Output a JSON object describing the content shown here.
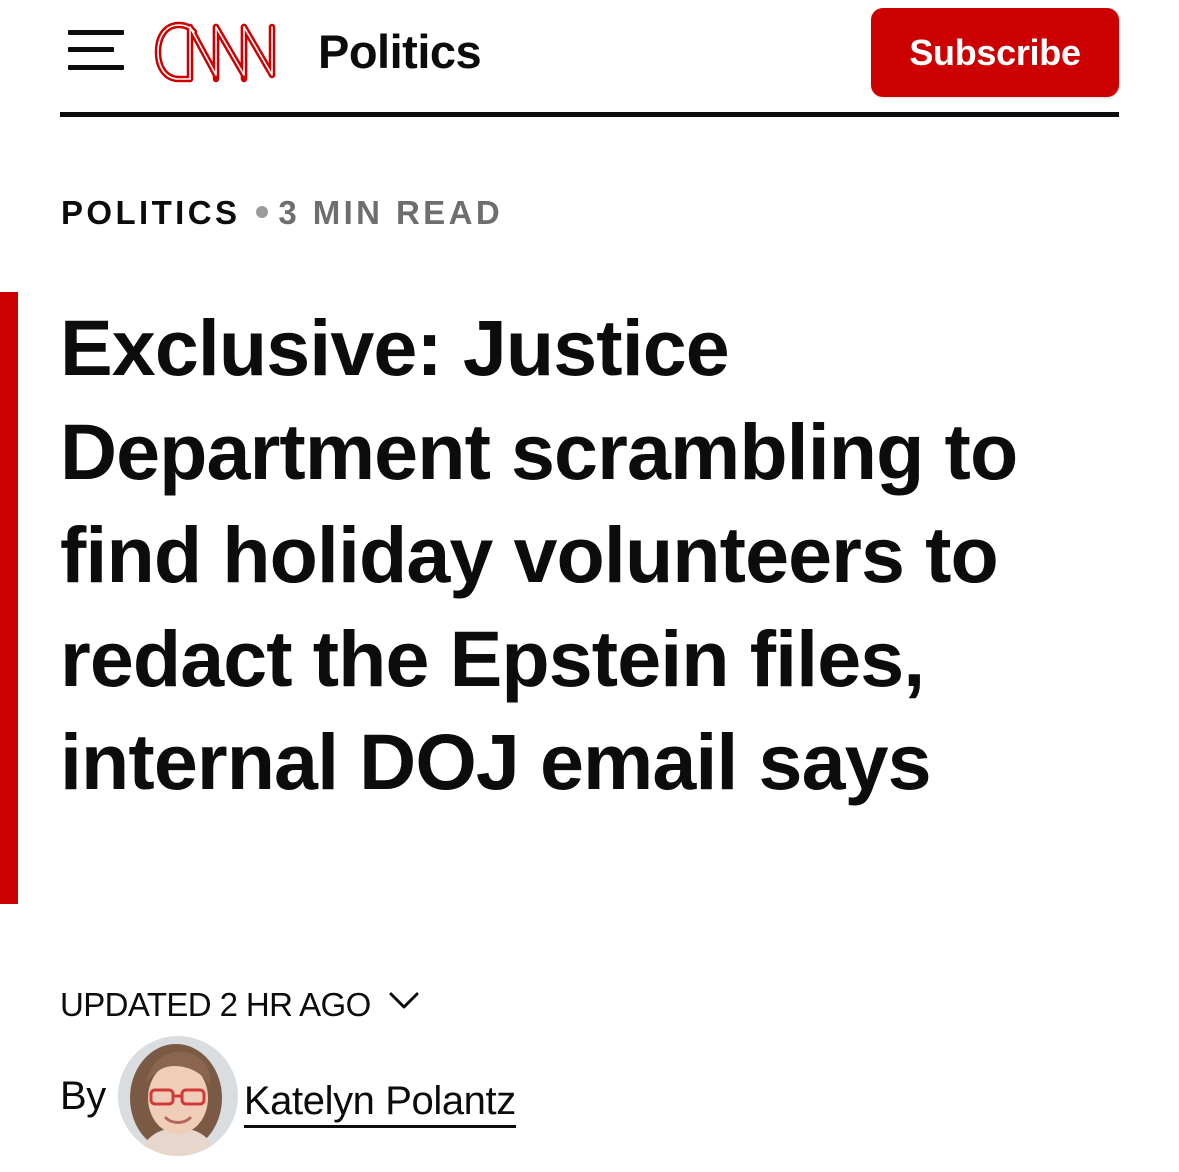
{
  "header": {
    "menu_icon": "hamburger-menu-icon",
    "logo_text": "CNN",
    "section_name": "Politics",
    "subscribe_label": "Subscribe",
    "brand_color": "#cc0000"
  },
  "article": {
    "category": "POLITICS",
    "read_time": "3 MIN READ",
    "headline": "Exclusive: Justice Department scrambling to find holiday volunteers to redact the Epstein files, internal DOJ email says",
    "updated": "Updated 2 hr ago",
    "by_label": "By",
    "author": "Katelyn Polantz"
  }
}
